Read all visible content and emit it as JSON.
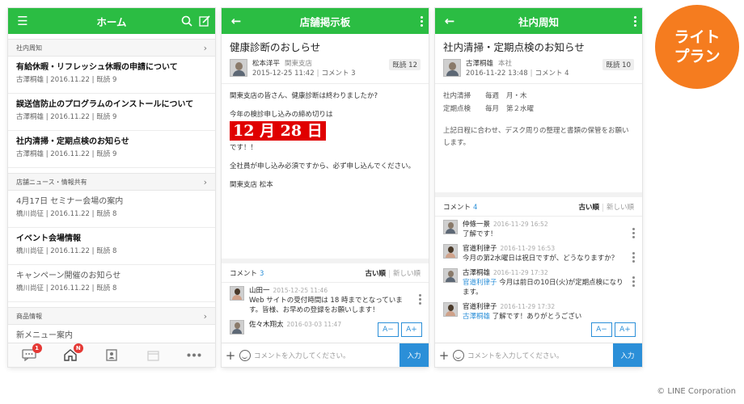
{
  "home": {
    "title": "ホーム",
    "sections": [
      {
        "label": "社内周知",
        "items": [
          {
            "title": "有給休暇・リフレッシュ休暇の申請について",
            "author": "古澤桐雄",
            "date": "2016.11.22",
            "reads": "既読 9",
            "unread": true
          },
          {
            "title": "誤送信防止のプログラムのインストールについて",
            "author": "古澤桐雄",
            "date": "2016.11.22",
            "reads": "既読 9",
            "unread": true
          },
          {
            "title": "社内清掃・定期点検のお知らせ",
            "author": "古澤桐雄",
            "date": "2016.11.22",
            "reads": "既読 9",
            "unread": true
          }
        ]
      },
      {
        "label": "店舗ニュース・情報共有",
        "items": [
          {
            "title": "4月17日 セミナー会場の案内",
            "author": "橋川尚征",
            "date": "2016.11.22",
            "reads": "既読 8",
            "unread": false
          },
          {
            "title": "イベント会場情報",
            "author": "橋川尚征",
            "date": "2016.11.22",
            "reads": "既読 8",
            "unread": true
          },
          {
            "title": "キャンペーン開催のお知らせ",
            "author": "橋川尚征",
            "date": "2016.11.22",
            "reads": "既読 8",
            "unread": false
          }
        ]
      },
      {
        "label": "商品情報",
        "items": [
          {
            "title": "新メニュー案内",
            "author": "",
            "date": "",
            "reads": "",
            "unread": false
          }
        ]
      }
    ],
    "nav": {
      "chat_badge": "1",
      "home_badge": "N"
    }
  },
  "board": {
    "title": "店舗掲示板",
    "post_title": "健康診断のおしらせ",
    "author": "松本洋平",
    "branch": "関東支店",
    "datetime": "2015-12-25 11:42",
    "comments_label": "コメント 3",
    "read_count": "既読 12",
    "body": {
      "p1": "関東支店の皆さん、健康診断は終わりましたか?",
      "p2": "今年の検診申し込みの締め切りは",
      "highlight": "12 月 28 日",
      "p3": "です！！",
      "p4": "全社員が申し込み必須ですから、必ず申し込んでください。",
      "sign": "関東支店 松本"
    },
    "comment_header": "コメント",
    "comment_count": "3",
    "sort_old": "古い順",
    "sort_new": "新しい順",
    "comments": [
      {
        "name": "山田一",
        "time": "2015-12-25 11:46",
        "text": "Web サイトの受付時間は 18 時までとなっています。皆様、お早めの登録をお願いします！"
      },
      {
        "name": "佐々木翔太",
        "time": "2016-03-03 11:47",
        "text": ""
      }
    ],
    "font_minus": "A−",
    "font_plus": "A+",
    "input_placeholder": "コメントを入力してください。",
    "send": "入力"
  },
  "notice": {
    "title": "社内周知",
    "post_title": "社内清掃・定期点検のお知らせ",
    "author": "古澤桐雄",
    "branch": "本社",
    "datetime": "2016-11-22 13:48",
    "comments_label": "コメント 4",
    "read_count": "既読 10",
    "body": {
      "row1_label": "社内清掃",
      "row1_v1": "毎週",
      "row1_v2": "月・木",
      "row2_label": "定期点検",
      "row2_v1": "毎月",
      "row2_v2": "第２水曜",
      "p1": "上記日程に合わせ、デスク周りの整理と書類の保管をお願いします。"
    },
    "comment_header": "コメント",
    "comment_count": "4",
    "sort_old": "古い順",
    "sort_new": "新しい順",
    "comments": [
      {
        "name": "仲條一景",
        "time": "2016-11-29 16:52",
        "mention": "",
        "text": "了解です！"
      },
      {
        "name": "官道利律子",
        "time": "2016-11-29 16:53",
        "mention": "",
        "text": "今月の第2水曜日は祝日ですが、どうなりますか？"
      },
      {
        "name": "古澤桐雄",
        "time": "2016-11-29 17:32",
        "mention": "官道利律子",
        "text": " 今月は前日の10日(火)が定期点検になります。"
      },
      {
        "name": "官道利律子",
        "time": "2016-11-29 17:32",
        "mention": "古澤桐雄",
        "text": " 了解です！ありがとうござい"
      }
    ],
    "font_minus": "A−",
    "font_plus": "A+",
    "input_placeholder": "コメントを入力してください。",
    "send": "入力"
  },
  "badge": {
    "line1": "ライト",
    "line2": "プラン"
  },
  "copyright": "© LINE Corporation"
}
